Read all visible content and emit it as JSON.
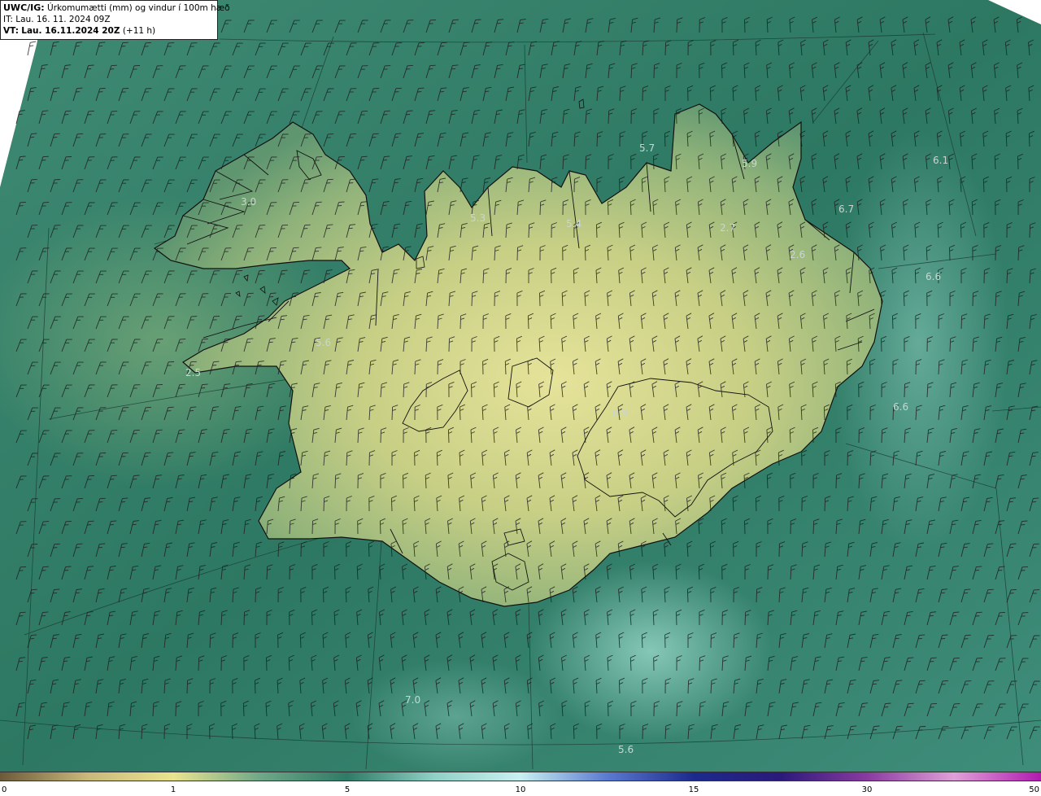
{
  "header": {
    "model": "UWC/IG:",
    "title": "Úrkomumætti (mm) og vindur í 100m hæð",
    "issue_label": "IT:",
    "issue_time": "Lau. 16. 11. 2024 09Z",
    "valid_label": "VT:",
    "valid_time": "Lau. 16.11.2024 20Z",
    "lead": "(+11 h)"
  },
  "colors": {
    "sea": "#2f7a66",
    "land_high": "#e4e29a",
    "coast": "#111111"
  },
  "map_labels": [
    {
      "id": "lbl-3-0",
      "text": "3.0"
    },
    {
      "id": "lbl-5-3",
      "text": "5.3"
    },
    {
      "id": "lbl-5-4",
      "text": "5.4"
    },
    {
      "id": "lbl-5-7",
      "text": "5.7"
    },
    {
      "id": "lbl-5-9",
      "text": "5.9"
    },
    {
      "id": "lbl-6-1",
      "text": "6.1"
    },
    {
      "id": "lbl-6-7",
      "text": "6.7"
    },
    {
      "id": "lbl-2-7",
      "text": "2.7"
    },
    {
      "id": "lbl-2-6",
      "text": "2.6"
    },
    {
      "id": "lbl-6-6a",
      "text": "6.6"
    },
    {
      "id": "lbl-5-6a",
      "text": "5.6"
    },
    {
      "id": "lbl-2-5",
      "text": "2.5"
    },
    {
      "id": "lbl-0-9",
      "text": "0.9"
    },
    {
      "id": "lbl-6-6b",
      "text": "6.6"
    },
    {
      "id": "lbl-7-0",
      "text": "7.0"
    },
    {
      "id": "lbl-5-6b",
      "text": "5.6"
    }
  ],
  "colorbar": {
    "ticks": [
      "0",
      "1",
      "5",
      "10",
      "15",
      "30",
      "50"
    ],
    "stops": [
      "#6b5a3a",
      "#c9b87a",
      "#e9e48f",
      "#6fa888",
      "#2f7a66",
      "#8fd0c6",
      "#c8f0f0",
      "#5a7ad0",
      "#1c2a8c",
      "#2a1a7a",
      "#8a3aa0",
      "#e0a0d8",
      "#b01ab0"
    ]
  }
}
